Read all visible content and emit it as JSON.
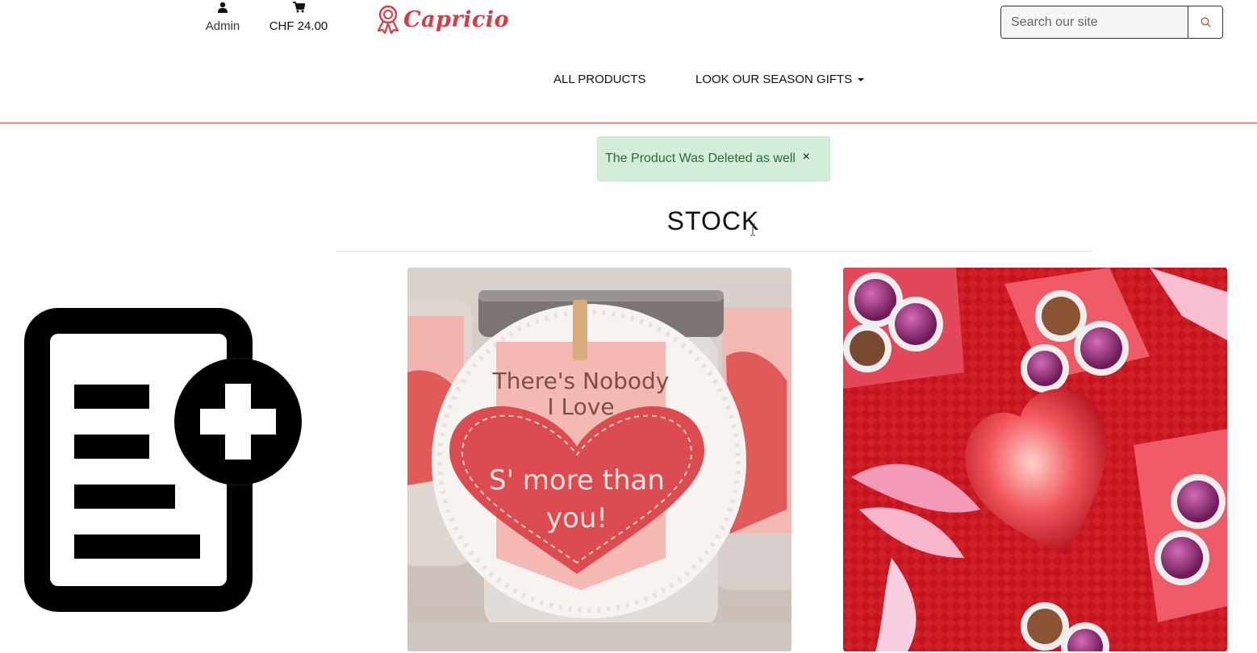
{
  "header": {
    "account": {
      "icon": "user-icon",
      "label": "Admin"
    },
    "cart": {
      "icon": "cart-icon",
      "total": "CHF 24.00"
    },
    "logo": {
      "icon": "ribbon-badge-icon",
      "text": "Capricio",
      "color": "#d63c43"
    },
    "search": {
      "placeholder": "Search our site",
      "value": "",
      "button_icon": "search-icon"
    }
  },
  "nav": {
    "items": [
      {
        "label": "ALL PRODUCTS"
      },
      {
        "label": "LOOK OUR SEASON GIFTS",
        "has_dropdown": true
      }
    ]
  },
  "alert": {
    "message": "The Product Was Deleted as well",
    "close_label": "×",
    "type": "success"
  },
  "main": {
    "title": "STOCK",
    "add_product_icon": "add-document-icon",
    "products": [
      {
        "image": "mason-jar-gift-photo",
        "tag_text": [
          "There's Nobody",
          "I Love"
        ],
        "heart_text": [
          "S' more than",
          "you!"
        ]
      },
      {
        "image": "sequin-heart-truffles-photo"
      }
    ]
  },
  "colors": {
    "accent": "#c1583f",
    "brand": "#d63c43",
    "alert_bg": "#d4edda",
    "alert_text": "#2b6a3a"
  }
}
